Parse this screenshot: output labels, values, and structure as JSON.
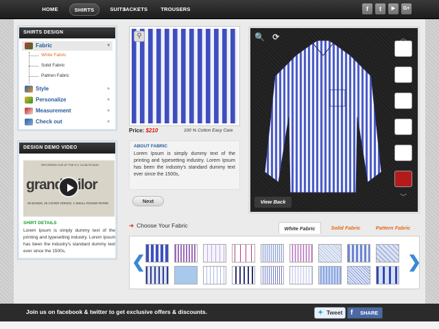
{
  "nav": {
    "items": [
      "HOME",
      "SHIRTS",
      "SUITS",
      "JACKETS",
      "TROUSERS"
    ],
    "active": "SHIRTS"
  },
  "social": {
    "icons": [
      "facebook-icon",
      "twitter-icon",
      "youtube-icon",
      "googleplus-icon"
    ],
    "labels": [
      "f",
      "t",
      "▶",
      "G+"
    ]
  },
  "design_panel": {
    "title": "SHIRTS DESIGN",
    "menu": [
      {
        "label": "Fabric",
        "arrow": "▾"
      },
      {
        "label": "Style",
        "arrow": "»"
      },
      {
        "label": "Personalize",
        "arrow": "»"
      },
      {
        "label": "Measurement",
        "arrow": "»"
      },
      {
        "label": "Check out",
        "arrow": "»"
      }
    ],
    "fabric_sub": [
      "White Fabric",
      "Solid Fabric",
      "Pattren Fabric"
    ]
  },
  "video_panel": {
    "title": "DESIGN DEMO VIDEO",
    "video_top": "RECORDED LIVE AT THE H.V. CLUB STUDIO",
    "video_big": "grand tailor",
    "video_bottom": "25 BANDS, 25 COVER SONGS, 1 SMALL ROUND ROOM",
    "details_title": "SHIRT DETAILS",
    "details_text": "Lorem Ipsum is simply dummy text of the printing and typesetting industry. Lorem Ipsum has been the industry's standard dummy text ever since the 1500s,"
  },
  "fabric": {
    "price_label": "Price:",
    "price_value": "$210",
    "material": "100 % Cotton Easy Care",
    "about_title": "ABOUT FABRIC",
    "about_text": "Lorem Ipsum is simply dummy text of the printing and typesetting industry. Lorem Ipsum has been the industry's standard dummy text ever since the 1500s,",
    "next_label": "Next"
  },
  "viewer": {
    "view_back_label": "View Back",
    "tools": "🔍 ⟳",
    "up_arrow": "︿",
    "down_arrow": "﹀"
  },
  "choose": {
    "arrow": "➜",
    "label": "Choose Your Fabric",
    "tabs": [
      "White Fabric",
      "Solid Fabric",
      "Pattern Fabric"
    ],
    "active_tab": "White Fabric",
    "prev": "❮",
    "next": "❯"
  },
  "footer": {
    "message": "Join us on facebook & twitter to get exclusive offers & discounts.",
    "tweet_label": "Tweet",
    "share_label": "SHARE"
  },
  "colors": {
    "accent": "#245b9c",
    "price": "#dd1111",
    "tab_orange": "#e06a1a",
    "green": "#1b9d2e"
  }
}
